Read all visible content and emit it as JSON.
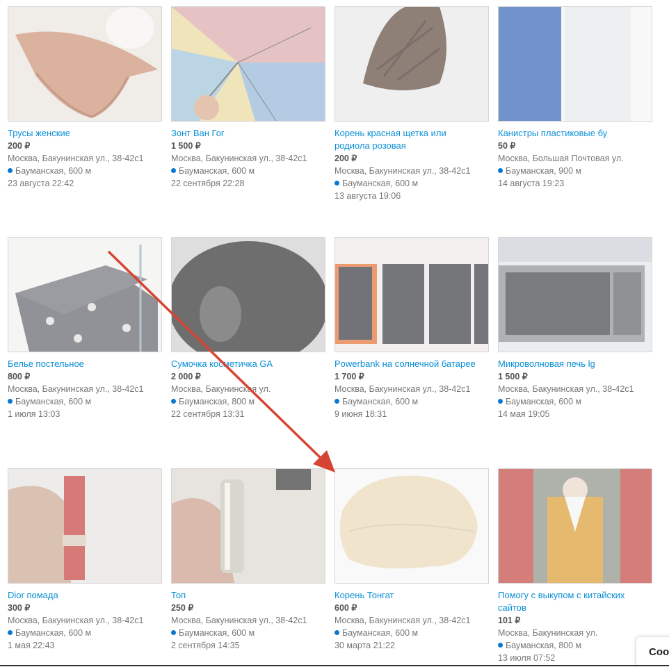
{
  "listings": [
    {
      "title": "Трусы женские",
      "price": "200 ₽",
      "address": "Москва, Бакунинская ул., 38-42с1",
      "metro": "Бауманская, 600 м",
      "date": "23 августа 22:42",
      "image": "panties-photo"
    },
    {
      "title": "Зонт Ван Гог",
      "price": "1 500 ₽",
      "address": "Москва, Бакунинская ул., 38-42с1",
      "metro": "Бауманская, 600 м",
      "date": "22 сентября 22:28",
      "image": "umbrella-photo"
    },
    {
      "title": "Корень красная щетка или родиола розовая",
      "price": "200 ₽",
      "address": "Москва, Бакунинская ул., 38-42с1",
      "metro": "Бауманская, 600 м",
      "date": "13 августа 19:06",
      "image": "root-photo"
    },
    {
      "title": "Канистры пластиковые бу",
      "price": "50 ₽",
      "address": "Москва, Большая Почтовая ул.",
      "metro": "Бауманская, 900 м",
      "date": "14 августа 19:23",
      "image": "canisters-photo"
    },
    {
      "title": "Белье постельное",
      "price": "800 ₽",
      "address": "Москва, Бакунинская ул., 38-42с1",
      "metro": "Бауманская, 600 м",
      "date": "1 июля 13:03",
      "image": "bedding-photo"
    },
    {
      "title": "Сумочка косметичка GA",
      "price": "2 000 ₽",
      "address": "Москва, Бакунинская ул.",
      "metro": "Бауманская, 800 м",
      "date": "22 сентября 13:31",
      "image": "cosmetic-bag-photo"
    },
    {
      "title": "Powerbank на солнечной батарее",
      "price": "1 700 ₽",
      "address": "Москва, Бакунинская ул., 38-42с1",
      "metro": "Бауманская, 600 м",
      "date": "9 июня 18:31",
      "image": "powerbank-photo"
    },
    {
      "title": "Микроволновая печь lg",
      "price": "1 500 ₽",
      "address": "Москва, Бакунинская ул., 38-42с1",
      "metro": "Бауманская, 600 м",
      "date": "14 мая 19:05",
      "image": "microwave-photo"
    },
    {
      "title": "Dior помада",
      "price": "300 ₽",
      "address": "Москва, Бакунинская ул., 38-42с1",
      "metro": "Бауманская, 600 м",
      "date": "1 мая 22:43",
      "image": "lipstick-photo"
    },
    {
      "title": "Топ",
      "price": "250 ₽",
      "address": "Москва, Бакунинская ул., 38-42с1",
      "metro": "Бауманская, 600 м",
      "date": "2 сентября 14:35",
      "image": "top-photo"
    },
    {
      "title": "Корень Тонгат",
      "price": "600 ₽",
      "address": "Москва, Бакунинская ул., 38-42с1",
      "metro": "Бауманская, 600 м",
      "date": "30 марта 21:22",
      "image": "tongkat-root-photo"
    },
    {
      "title": "Помогу с выкупом с китайских сайтов",
      "price": "101 ₽",
      "address": "Москва, Бакунинская ул.",
      "metro": "Бауманская, 800 м",
      "date": "13 июля 07:52",
      "image": "statue-photo"
    }
  ],
  "cookie_banner": {
    "label": "Coo"
  },
  "colors": {
    "link": "#0a8fd6",
    "metro_dot": "#0a78d0",
    "arrow": "#d64533"
  }
}
